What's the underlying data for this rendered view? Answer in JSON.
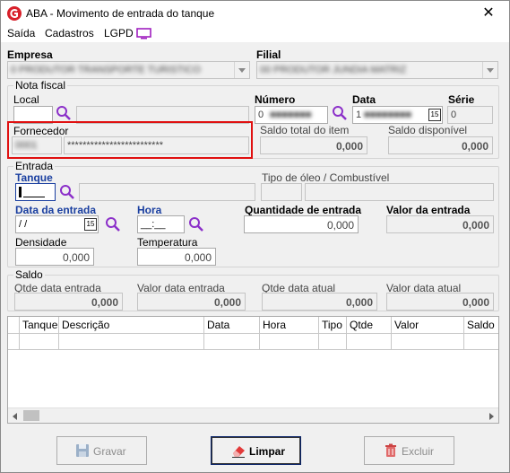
{
  "window": {
    "title": "ABA - Movimento de entrada do tanque",
    "close_glyph": "✕"
  },
  "menu": {
    "items": [
      "Saída",
      "Cadastros",
      "LGPD"
    ]
  },
  "empresa": {
    "label": "Empresa",
    "value": "0 PRODUTOR TRANSPORTE TURISTICO"
  },
  "filial": {
    "label": "Filial",
    "value": "00 PRODUTOR JUNDIA MATRIZ"
  },
  "nota_fiscal": {
    "legend": "Nota fiscal",
    "local_label": "Local",
    "numero_label": "Número",
    "numero_value": "0",
    "data_label": "Data",
    "data_value": "1",
    "serie_label": "Série",
    "serie_value": "0",
    "fornecedor_label": "Fornecedor",
    "fornecedor_code": "0001",
    "fornecedor_name": "*************************",
    "saldo_total_label": "Saldo total do item",
    "saldo_total_value": "0,000",
    "saldo_disp_label": "Saldo disponível",
    "saldo_disp_value": "0,000"
  },
  "entrada": {
    "legend": "Entrada",
    "tanque_label": "Tanque",
    "tipo_oleo_label": "Tipo de óleo / Combustível",
    "data_entrada_label": "Data da entrada",
    "data_entrada_value": " /  /",
    "hora_label": "Hora",
    "hora_value": "__:__",
    "qtd_label": "Quantidade de entrada",
    "qtd_value": "0,000",
    "valor_label": "Valor da entrada",
    "valor_value": "0,000",
    "densidade_label": "Densidade",
    "densidade_value": "0,000",
    "temperatura_label": "Temperatura",
    "temperatura_value": "0,000"
  },
  "saldo": {
    "legend": "Saldo",
    "qtde_entrada_label": "Qtde data entrada",
    "qtde_entrada_value": "0,000",
    "valor_entrada_label": "Valor data entrada",
    "valor_entrada_value": "0,000",
    "qtde_atual_label": "Qtde data atual",
    "qtde_atual_value": "0,000",
    "valor_atual_label": "Valor data atual",
    "valor_atual_value": "0,000"
  },
  "grid": {
    "columns": [
      "Tanque",
      "Descrição",
      "Data",
      "Hora",
      "Tipo",
      "Qtde",
      "Valor",
      "Saldo"
    ]
  },
  "buttons": {
    "gravar": "Gravar",
    "limpar": "Limpar",
    "excluir": "Excluir"
  },
  "calendar_day": "15",
  "colors": {
    "accent": "#1a3fa0",
    "search": "#8b2fc9",
    "highlight": "#e01010"
  }
}
